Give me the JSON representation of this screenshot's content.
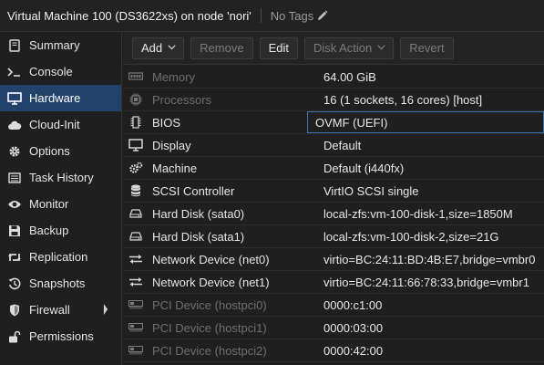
{
  "header": {
    "title": "Virtual Machine 100 (DS3622xs) on node 'nori'",
    "tags_label": "No Tags"
  },
  "sidebar": {
    "items": [
      {
        "label": "Summary",
        "icon": "book-icon"
      },
      {
        "label": "Console",
        "icon": "terminal-icon"
      },
      {
        "label": "Hardware",
        "icon": "monitor-icon",
        "active": true
      },
      {
        "label": "Cloud-Init",
        "icon": "cloud-icon"
      },
      {
        "label": "Options",
        "icon": "gear-icon"
      },
      {
        "label": "Task History",
        "icon": "list-icon"
      },
      {
        "label": "Monitor",
        "icon": "eye-icon"
      },
      {
        "label": "Backup",
        "icon": "floppy-icon"
      },
      {
        "label": "Replication",
        "icon": "retweet-icon"
      },
      {
        "label": "Snapshots",
        "icon": "history-icon"
      },
      {
        "label": "Firewall",
        "icon": "shield-icon"
      },
      {
        "label": "Permissions",
        "icon": "unlock-icon"
      }
    ]
  },
  "toolbar": {
    "add": "Add",
    "remove": "Remove",
    "edit": "Edit",
    "disk_action": "Disk Action",
    "revert": "Revert"
  },
  "hardware": {
    "rows": [
      {
        "key": "Memory",
        "value": "64.00 GiB",
        "icon": "memory-icon"
      },
      {
        "key": "Processors",
        "value": "16 (1 sockets, 16 cores) [host]",
        "icon": "cpu-icon"
      },
      {
        "key": "BIOS",
        "value": "OVMF (UEFI)",
        "icon": "microchip-icon"
      },
      {
        "key": "Display",
        "value": "Default",
        "icon": "desktop-icon"
      },
      {
        "key": "Machine",
        "value": "Default (i440fx)",
        "icon": "cogs-icon"
      },
      {
        "key": "SCSI Controller",
        "value": "VirtIO SCSI single",
        "icon": "database-icon"
      },
      {
        "key": "Hard Disk (sata0)",
        "value": "local-zfs:vm-100-disk-1,size=1850M",
        "icon": "hdd-icon"
      },
      {
        "key": "Hard Disk (sata1)",
        "value": "local-zfs:vm-100-disk-2,size=21G",
        "icon": "hdd-icon"
      },
      {
        "key": "Network Device (net0)",
        "value": "virtio=BC:24:11:BD:4B:E7,bridge=vmbr0",
        "icon": "exchange-icon"
      },
      {
        "key": "Network Device (net1)",
        "value": "virtio=BC:24:11:66:78:33,bridge=vmbr1",
        "icon": "exchange-icon"
      },
      {
        "key": "PCI Device (hostpci0)",
        "value": "0000:c1:00",
        "icon": "pci-icon"
      },
      {
        "key": "PCI Device (hostpci1)",
        "value": "0000:03:00",
        "icon": "pci-icon"
      },
      {
        "key": "PCI Device (hostpci2)",
        "value": "0000:42:00",
        "icon": "pci-icon"
      }
    ]
  }
}
